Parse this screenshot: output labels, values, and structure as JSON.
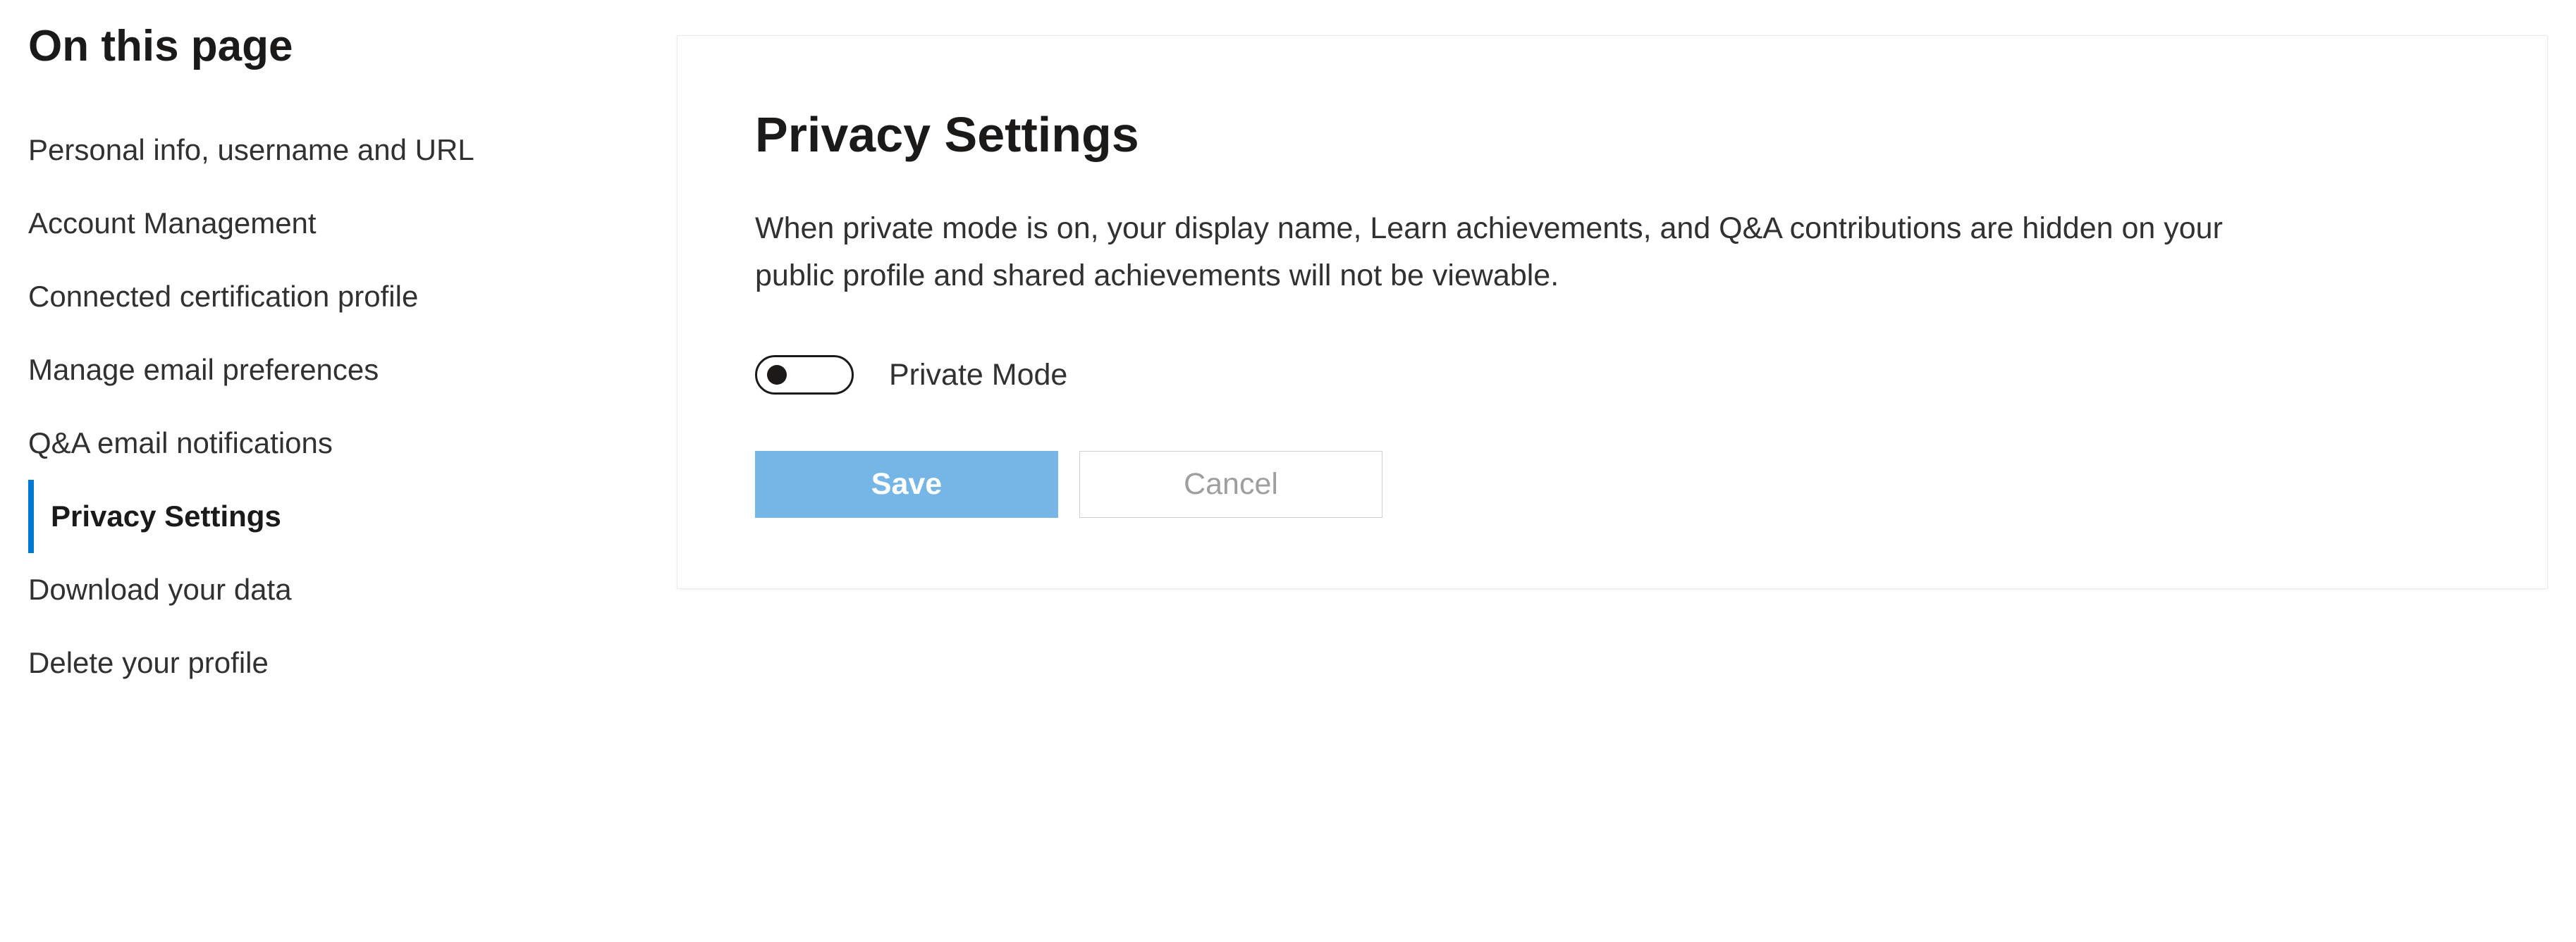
{
  "sidebar": {
    "title": "On this page",
    "items": [
      {
        "label": "Personal info, username and URL",
        "active": false
      },
      {
        "label": "Account Management",
        "active": false
      },
      {
        "label": "Connected certification profile",
        "active": false
      },
      {
        "label": "Manage email preferences",
        "active": false
      },
      {
        "label": "Q&A email notifications",
        "active": false
      },
      {
        "label": "Privacy Settings",
        "active": true
      },
      {
        "label": "Download your data",
        "active": false
      },
      {
        "label": "Delete your profile",
        "active": false
      }
    ]
  },
  "main": {
    "title": "Privacy Settings",
    "description": "When private mode is on, your display name, Learn achievements, and Q&A contributions are hidden on your public profile and shared achievements will not be viewable.",
    "toggle": {
      "label": "Private Mode",
      "checked": false
    },
    "buttons": {
      "save": "Save",
      "cancel": "Cancel"
    }
  }
}
